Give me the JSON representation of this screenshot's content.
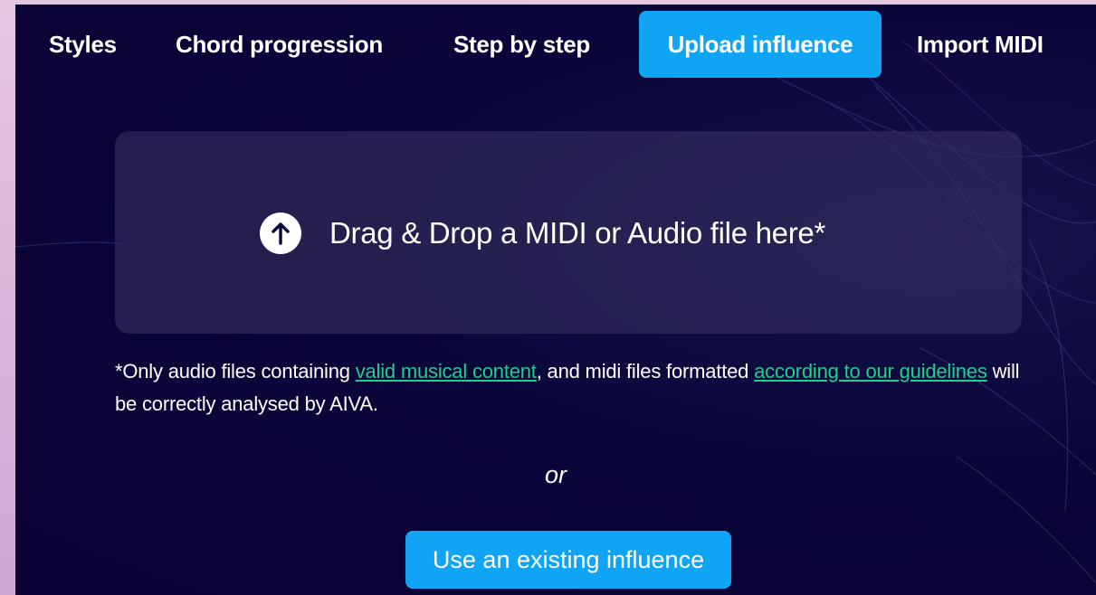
{
  "tabs": [
    {
      "label": "Styles",
      "active": false
    },
    {
      "label": "Chord progression",
      "active": false
    },
    {
      "label": "Step by step",
      "active": false
    },
    {
      "label": "Upload influence",
      "active": true
    },
    {
      "label": "Import MIDI",
      "active": false
    }
  ],
  "dropzone": {
    "icon": "arrow-up-circle-icon",
    "text": "Drag & Drop a MIDI or Audio file here*"
  },
  "note": {
    "part1": "*Only audio files containing ",
    "link1": "valid musical content",
    "part2": ", and midi files formatted ",
    "link2": "according to our guidelines",
    "part3": " will be correctly analysed by AIVA."
  },
  "separator": "or",
  "existing_button": "Use an existing influence",
  "colors": {
    "accent": "#10a4f5",
    "link": "#1fcf8a",
    "panel_bg": "#090234",
    "page_bg": "#d9b6d9"
  }
}
